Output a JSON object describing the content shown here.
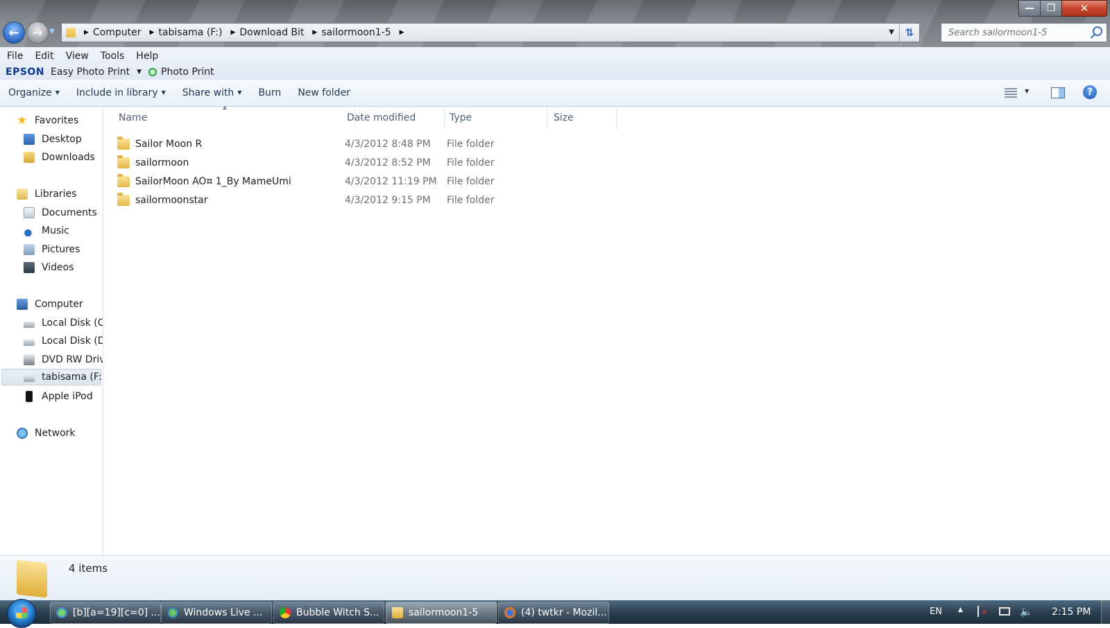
{
  "window": {
    "breadcrumbs": [
      "Computer",
      "tabisama (F:)",
      "Download Bit",
      "sailormoon1-5"
    ],
    "search_placeholder": "Search sailormoon1-5"
  },
  "menu": [
    "File",
    "Edit",
    "View",
    "Tools",
    "Help"
  ],
  "epson": {
    "brand": "EPSON",
    "easy_photo_print": "Easy Photo Print",
    "photo_print": "Photo Print"
  },
  "commandbar": {
    "organize": "Organize",
    "include_in_library": "Include in library",
    "share_with": "Share with",
    "burn": "Burn",
    "new_folder": "New folder"
  },
  "navigation": {
    "favorites": {
      "label": "Favorites",
      "items": [
        "Desktop",
        "Downloads"
      ]
    },
    "libraries": {
      "label": "Libraries",
      "items": [
        "Documents",
        "Music",
        "Pictures",
        "Videos"
      ]
    },
    "computer": {
      "label": "Computer",
      "items": [
        "Local Disk (C:",
        "Local Disk (D",
        "DVD RW Driv",
        "tabisama (F:)",
        "Apple iPod"
      ]
    },
    "network": {
      "label": "Network"
    }
  },
  "columns": {
    "name": "Name",
    "date": "Date modified",
    "type": "Type",
    "size": "Size"
  },
  "files": [
    {
      "name": "Sailor Moon R",
      "date": "4/3/2012 8:48 PM",
      "type": "File folder"
    },
    {
      "name": "sailormoon",
      "date": "4/3/2012 8:52 PM",
      "type": "File folder"
    },
    {
      "name": "SailorMoon ÀÒ¤ 1_By MameUmi",
      "date": "4/3/2012 11:19 PM",
      "type": "File folder"
    },
    {
      "name": "sailormoonstar",
      "date": "4/3/2012 9:15 PM",
      "type": "File folder"
    }
  ],
  "details": {
    "item_count": "4 items"
  },
  "taskbar": {
    "buttons": [
      "[b][a=19][c=0] ...",
      "Windows Live ...",
      "Bubble Witch S...",
      "sailormoon1-5",
      "(4) twtkr - Mozil..."
    ],
    "active_index": 3,
    "language": "EN",
    "clock": "2:15 PM"
  }
}
